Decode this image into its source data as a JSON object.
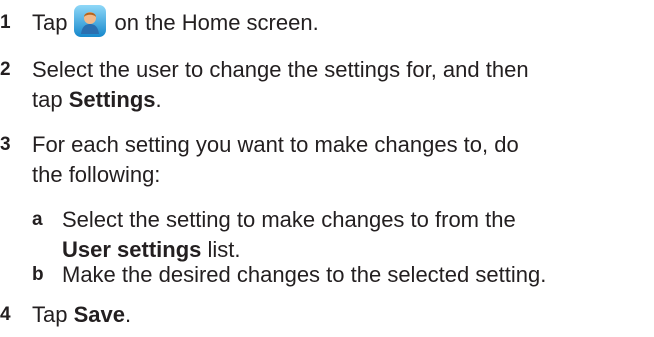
{
  "steps": [
    {
      "number": "1",
      "before_icon": "Tap",
      "icon": "user-profile-icon",
      "after_icon": "on the Home screen."
    },
    {
      "number": "2",
      "line1": "Select the user to change the settings for, and then",
      "line2_prefix": "tap ",
      "line2_bold": "Settings",
      "line2_suffix": "."
    },
    {
      "number": "3",
      "line1": "For each setting you want to make changes to, do",
      "line2": "the following:",
      "substeps": [
        {
          "letter": "a",
          "line1": "Select the setting to make changes to from the",
          "line2_bold": "User settings",
          "line2_suffix": " list."
        },
        {
          "letter": "b",
          "line1": "Make the desired changes to the selected setting."
        }
      ]
    },
    {
      "number": "4",
      "prefix": "Tap ",
      "bold": "Save",
      "suffix": "."
    }
  ],
  "colors": {
    "text": "#231f20",
    "icon_bg_top": "#7fd0f5",
    "icon_bg_bottom": "#1a8fd0",
    "icon_face": "#f2b98a",
    "icon_hair": "#b5651d"
  }
}
